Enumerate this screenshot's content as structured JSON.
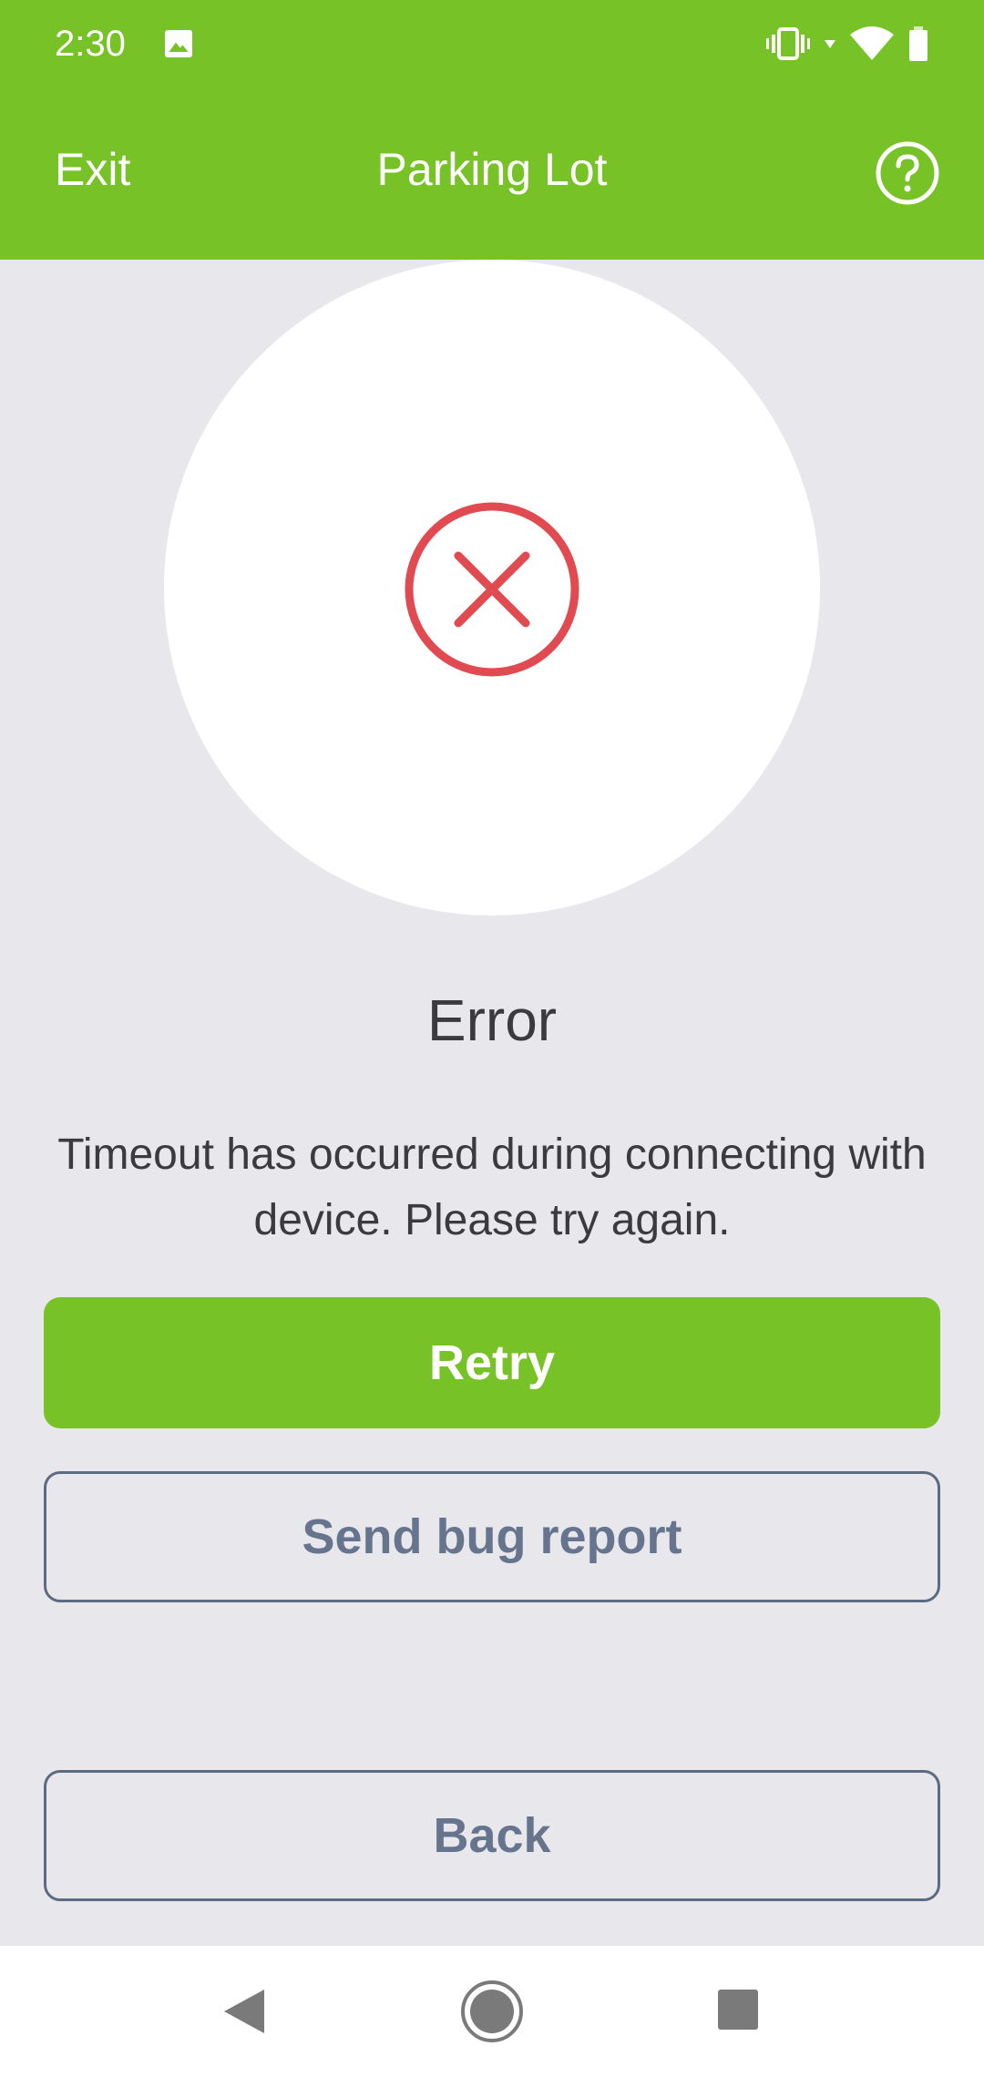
{
  "status_bar": {
    "time": "2:30",
    "icons": [
      "image-icon",
      "vibrate-icon",
      "wifi-icon",
      "battery-icon"
    ]
  },
  "app_bar": {
    "exit_label": "Exit",
    "title": "Parking Lot",
    "help_icon": "help-circle-icon"
  },
  "main": {
    "status_icon": "error-x-circle-icon",
    "title": "Error",
    "message": "Timeout has occurred during connecting with device. Please try again."
  },
  "buttons": {
    "retry_label": "Retry",
    "bug_report_label": "Send bug report",
    "back_label": "Back"
  },
  "nav_bar": {
    "icons": [
      "nav-back-icon",
      "nav-home-icon",
      "nav-recents-icon"
    ]
  },
  "colors": {
    "brand_green": "#77c226",
    "error_red": "#e04a50",
    "background": "#e8e8ec",
    "outline_text": "#66758d"
  }
}
